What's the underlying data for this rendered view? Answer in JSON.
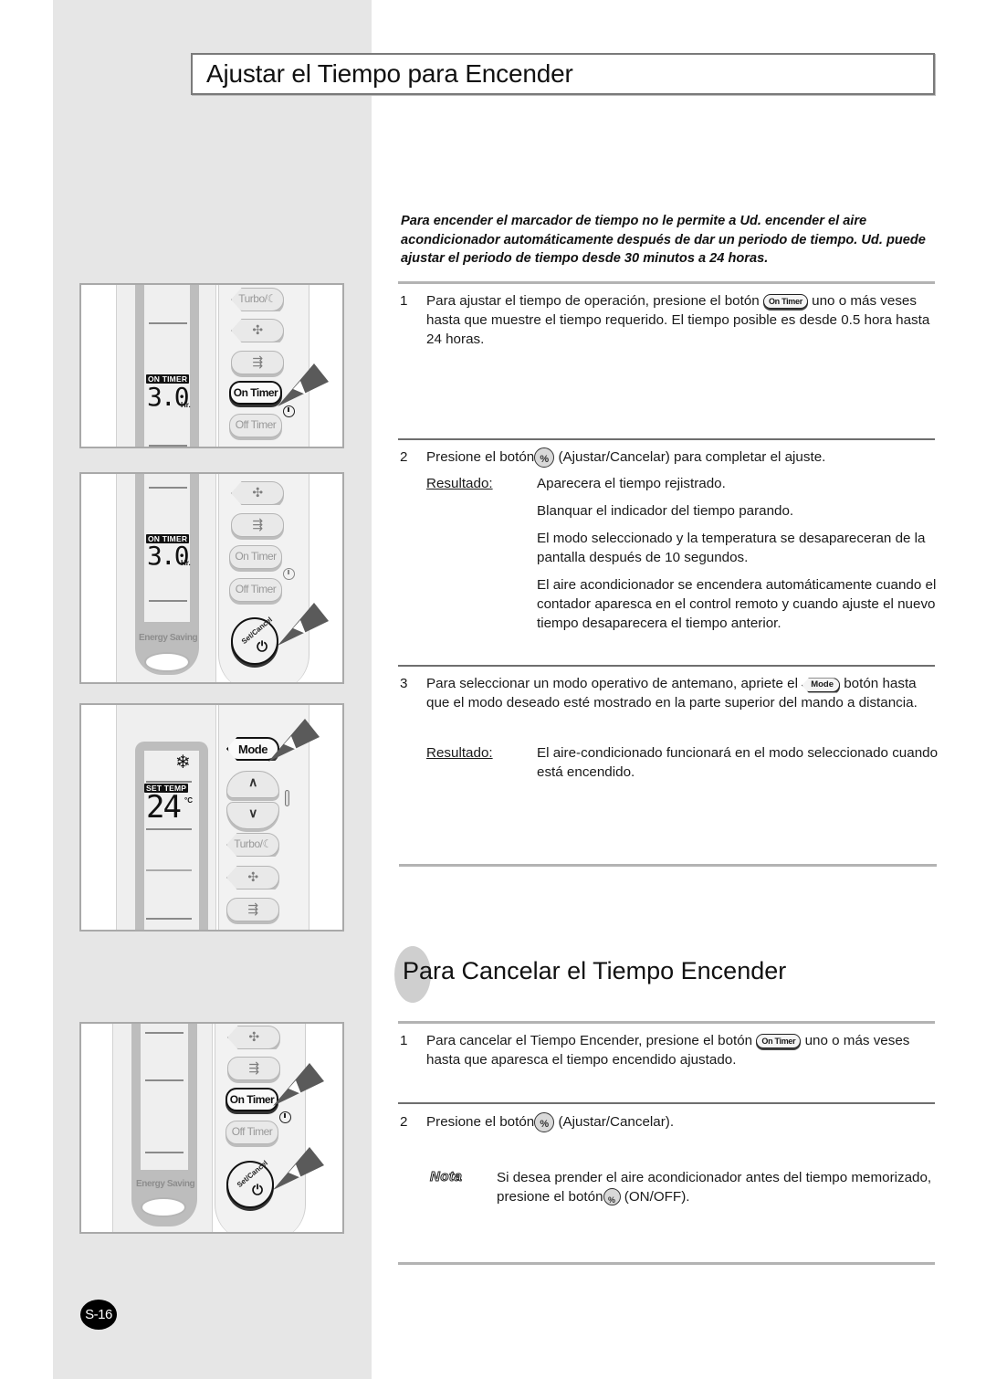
{
  "page": {
    "title": "Ajustar el Tiempo para Encender",
    "page_number": "S-16",
    "colors": {
      "sidebar": "#e6e6e6",
      "rule": "#9b9b9b",
      "badge": "#000000"
    }
  },
  "intro": "Para encender el marcador de tiempo no le permite a Ud. encender el aire acondicionador automáticamente después de dar un periodo de tiempo. Ud. puede ajustar el periodo de tiempo desde 30 minutos a 24 horas.",
  "section1": {
    "steps": [
      {
        "num": "1",
        "text_before": "Para ajustar el tiempo de operación, presione el botón",
        "button": "On Timer",
        "text_after": "uno o más veses hasta que muestre el tiempo requerido. El tiempo posible es desde 0.5 hora hasta 24 horas."
      },
      {
        "num": "2",
        "text_before": "Presione el botón",
        "button_icon": "set-cancel-icon",
        "text_after": "(Ajustar/Cancelar) para completar el ajuste.",
        "result_label": "Resultado:",
        "results": [
          "Aparecera el tiempo rejistrado.",
          "Blanquar el indicador del tiempo parando.",
          "El modo seleccionado y la temperatura se desapareceran de la pantalla después de 10 segundos.",
          "El aire acondicionador se encendera automáticamente cuando el contador aparesca en el control remoto y cuando ajuste el nuevo tiempo desaparecera el tiempo anterior."
        ]
      },
      {
        "num": "3",
        "text_before": "Para seleccionar un modo operativo de antemano, apriete el",
        "button": "Mode",
        "text_after": "botón hasta que el modo deseado esté mostrado en la parte superior del mando a distancia.",
        "result_label": "Resultado:",
        "results": [
          "El aire-condicionado funcionará en el modo seleccionado cuando está encendido."
        ]
      }
    ]
  },
  "section2": {
    "title": "Para Cancelar el Tiempo Encender",
    "steps": [
      {
        "num": "1",
        "text_before": "Para cancelar el Tiempo Encender, presione el botón",
        "button": "On Timer",
        "text_after": "uno o más veses hasta que aparesca el tiempo encendido ajustado."
      },
      {
        "num": "2",
        "text_before": "Presione el botón",
        "button_icon": "set-cancel-icon",
        "text_after": "(Ajustar/Cancelar)."
      }
    ],
    "note_label": "Nota",
    "note_before": "Si desea prender el aire acondicionador antes del tiempo memorizado, presione el botón",
    "note_after": "(ON/OFF)."
  },
  "remotes": {
    "panel1": {
      "lcd_tag": "ON TIMER",
      "lcd_value": "3.0",
      "lcd_unit": "Hr.",
      "buttons": [
        "Turbo/",
        "fan",
        "swing",
        "On Timer",
        "Off Timer"
      ],
      "active": "On Timer"
    },
    "panel2": {
      "lcd_tag": "ON TIMER",
      "lcd_value": "3.0",
      "lcd_unit": "Hr.",
      "buttons": [
        "fan",
        "swing",
        "On Timer",
        "Off Timer"
      ],
      "energy_label": "Energy Saving",
      "setcancel_label": "Set/Cancel",
      "active": "Set/Cancel"
    },
    "panel3": {
      "lcd_tag": "SET TEMP",
      "lcd_value": "24",
      "lcd_unit": "°C",
      "buttons": [
        "Mode",
        "up",
        "down",
        "Turbo/",
        "fan",
        "swing"
      ],
      "active": "Mode"
    },
    "panel4": {
      "buttons": [
        "fan",
        "swing",
        "On Timer",
        "Off Timer"
      ],
      "energy_label": "Energy Saving",
      "setcancel_label": "Set/Cancel",
      "active": [
        "On Timer",
        "Set/Cancel"
      ]
    }
  }
}
